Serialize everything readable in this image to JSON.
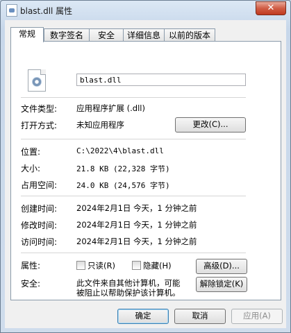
{
  "window": {
    "title": "blast.dll 属性",
    "close_label": "✕"
  },
  "tabs": [
    {
      "label": "常规"
    },
    {
      "label": "数字签名"
    },
    {
      "label": "安全"
    },
    {
      "label": "详细信息"
    },
    {
      "label": "以前的版本"
    }
  ],
  "general": {
    "filename": "blast.dll",
    "type_label": "文件类型:",
    "type_value": "应用程序扩展 (.dll)",
    "openwith_label": "打开方式:",
    "openwith_value": "未知应用程序",
    "change_button": "更改(C)...",
    "location_label": "位置:",
    "location_value": "C:\\2022\\4\\blast.dll",
    "size_label": "大小:",
    "size_value": "21.8 KB (22,328 字节)",
    "disksize_label": "占用空间:",
    "disksize_value": "24.0 KB (24,576 字节)",
    "created_label": "创建时间:",
    "created_value": "2024年2月1日 今天，1 分钟之前",
    "modified_label": "修改时间:",
    "modified_value": "2024年2月1日 今天，1 分钟之前",
    "accessed_label": "访问时间:",
    "accessed_value": "2024年2月1日 今天，1 分钟之前",
    "attributes_label": "属性:",
    "readonly_label": "只读(R)",
    "hidden_label": "隐藏(H)",
    "advanced_button": "高级(D)...",
    "security_label": "安全:",
    "security_text_line1": "此文件来自其他计算机，可能",
    "security_text_line2": "被阻止以帮助保护该计算机。",
    "unblock_button": "解除锁定(K)"
  },
  "footer": {
    "ok": "确定",
    "cancel": "取消",
    "apply": "应用(A)"
  }
}
